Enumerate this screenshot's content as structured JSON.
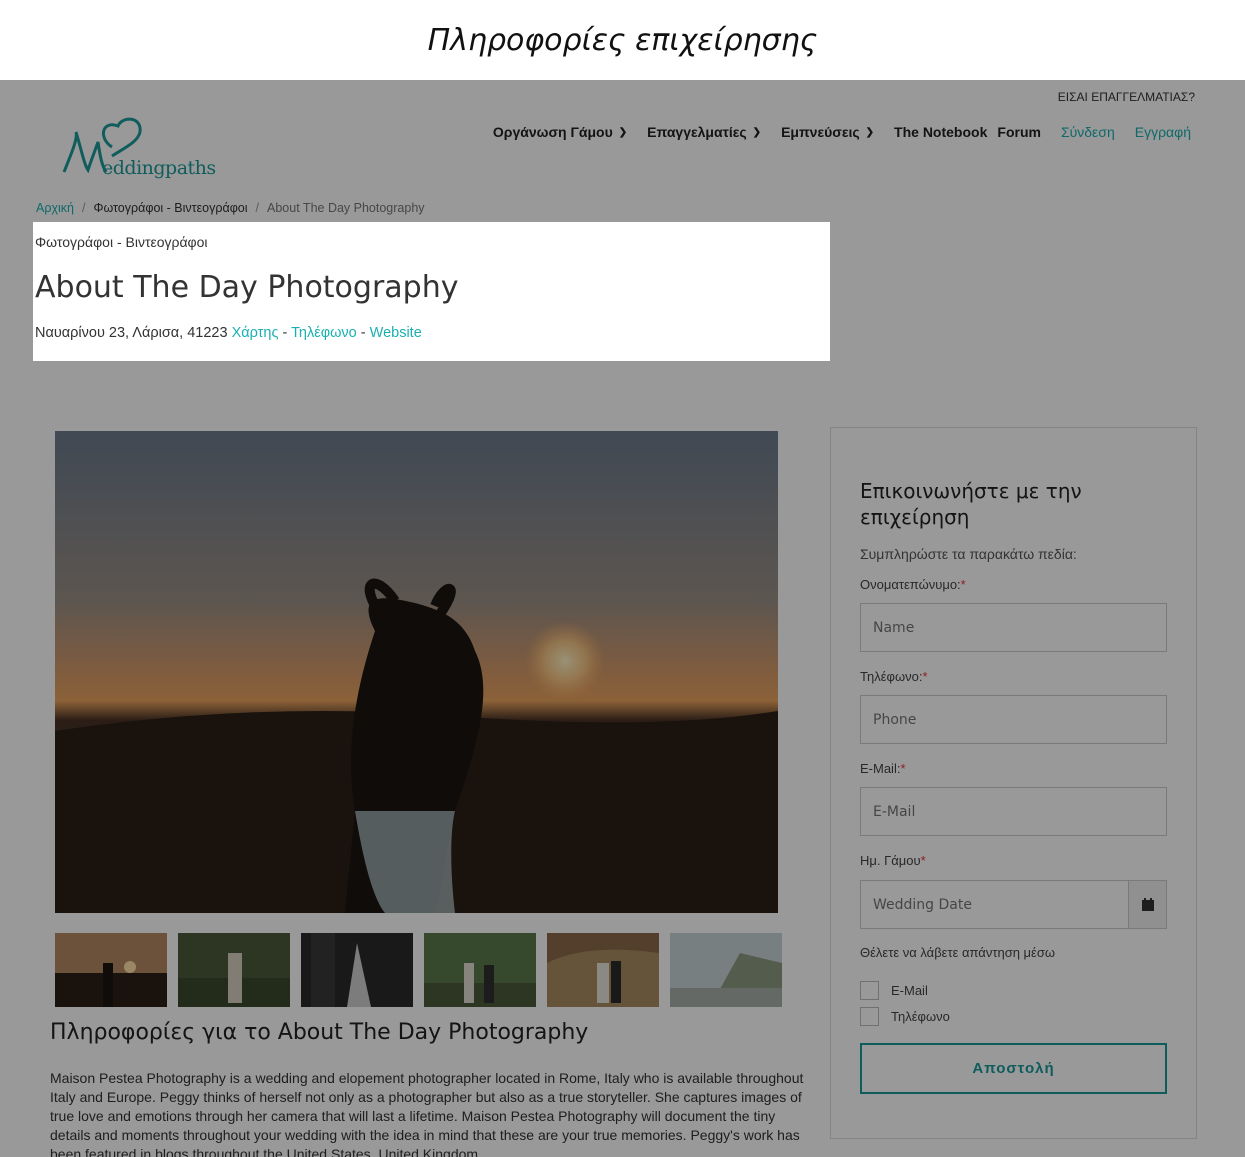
{
  "caption": "Πληροφορίες επιχείρησης",
  "site": {
    "pro_link": "ΕΙΣΑΙ ΕΠΑΓΓΕΛΜΑΤΙΑΣ?",
    "logo_text": "eddingpaths",
    "nav": {
      "wedding_planning": "Οργάνωση Γάμου",
      "professionals": "Επαγγελματίες",
      "inspirations": "Εμπνεύσεις",
      "notebook": "The Notebook",
      "forum": "Forum",
      "login": "Σύνδεση",
      "register": "Εγγραφή"
    },
    "breadcrumb": {
      "home": "Αρχική",
      "category": "Φωτογράφοι - Βιντεογράφοι",
      "current": "About The Day Photography"
    }
  },
  "business": {
    "category": "Φωτογράφοι - Βιντεογράφοι",
    "name": "About The Day Photography",
    "address": "Ναυαρίνου 23, Λάρισα, 41223",
    "map_link": "Χάρτης",
    "phone_link": "Τηλέφωνο",
    "website_link": "Website",
    "separator": "-"
  },
  "about": {
    "title": "Πληροφορίες για το About The Day Photography",
    "text": "Maison Pestea Photography is a wedding and elopement photographer located in Rome, Italy who is available throughout Italy and Europe. Peggy thinks of herself not only as a photographer but also as a true storyteller. She captures images of true love and emotions through her camera that will last a lifetime. Maison Pestea Photography will document the tiny details and moments throughout your wedding with the idea in mind that these are your true memories. Peggy's work has been featured in blogs throughout the United States, United Kingdom,"
  },
  "form": {
    "title": "Επικοινωνήστε με την επιχείρηση",
    "subtitle": "Συμπληρώστε τα παρακάτω πεδία:",
    "name_label": "Ονοματεπώνυμο:",
    "name_placeholder": "Name",
    "phone_label": "Τηλέφωνο:",
    "phone_placeholder": "Phone",
    "email_label": "E-Mail:",
    "email_placeholder": "E-Mail",
    "date_label": "Ημ. Γάμου",
    "date_placeholder": "Wedding Date",
    "reply_label": "Θέλετε να λάβετε απάντηση μέσω",
    "reply_email": "E-Mail",
    "reply_phone": "Τηλέφωνο",
    "required_mark": "*",
    "submit": "Αποστολή"
  },
  "colors": {
    "accent": "#1ab0b0",
    "button": "#1a9a9a",
    "overlay": "rgba(0,0,0,0.40)"
  }
}
